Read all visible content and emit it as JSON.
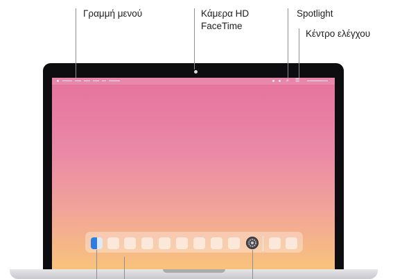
{
  "callouts": {
    "menu_bar": "Γραμμή μενού",
    "camera_line1": "Κάμερα HD",
    "camera_line2": "FaceTime",
    "spotlight": "Spotlight",
    "control_center": "Κέντρο ελέγχου"
  },
  "icons": {
    "camera": "camera-icon",
    "finder": "finder-icon",
    "system_settings": "gear-icon",
    "apple_menu": "apple-icon",
    "wifi": "wifi-icon",
    "search": "search-icon",
    "control_center": "control-center-icon"
  },
  "colors": {
    "bezel": "#0d0d0f",
    "wallpaper_top": "#e5739c",
    "wallpaper_bottom": "#f8c37c",
    "leader_line": "#8e8e93"
  }
}
